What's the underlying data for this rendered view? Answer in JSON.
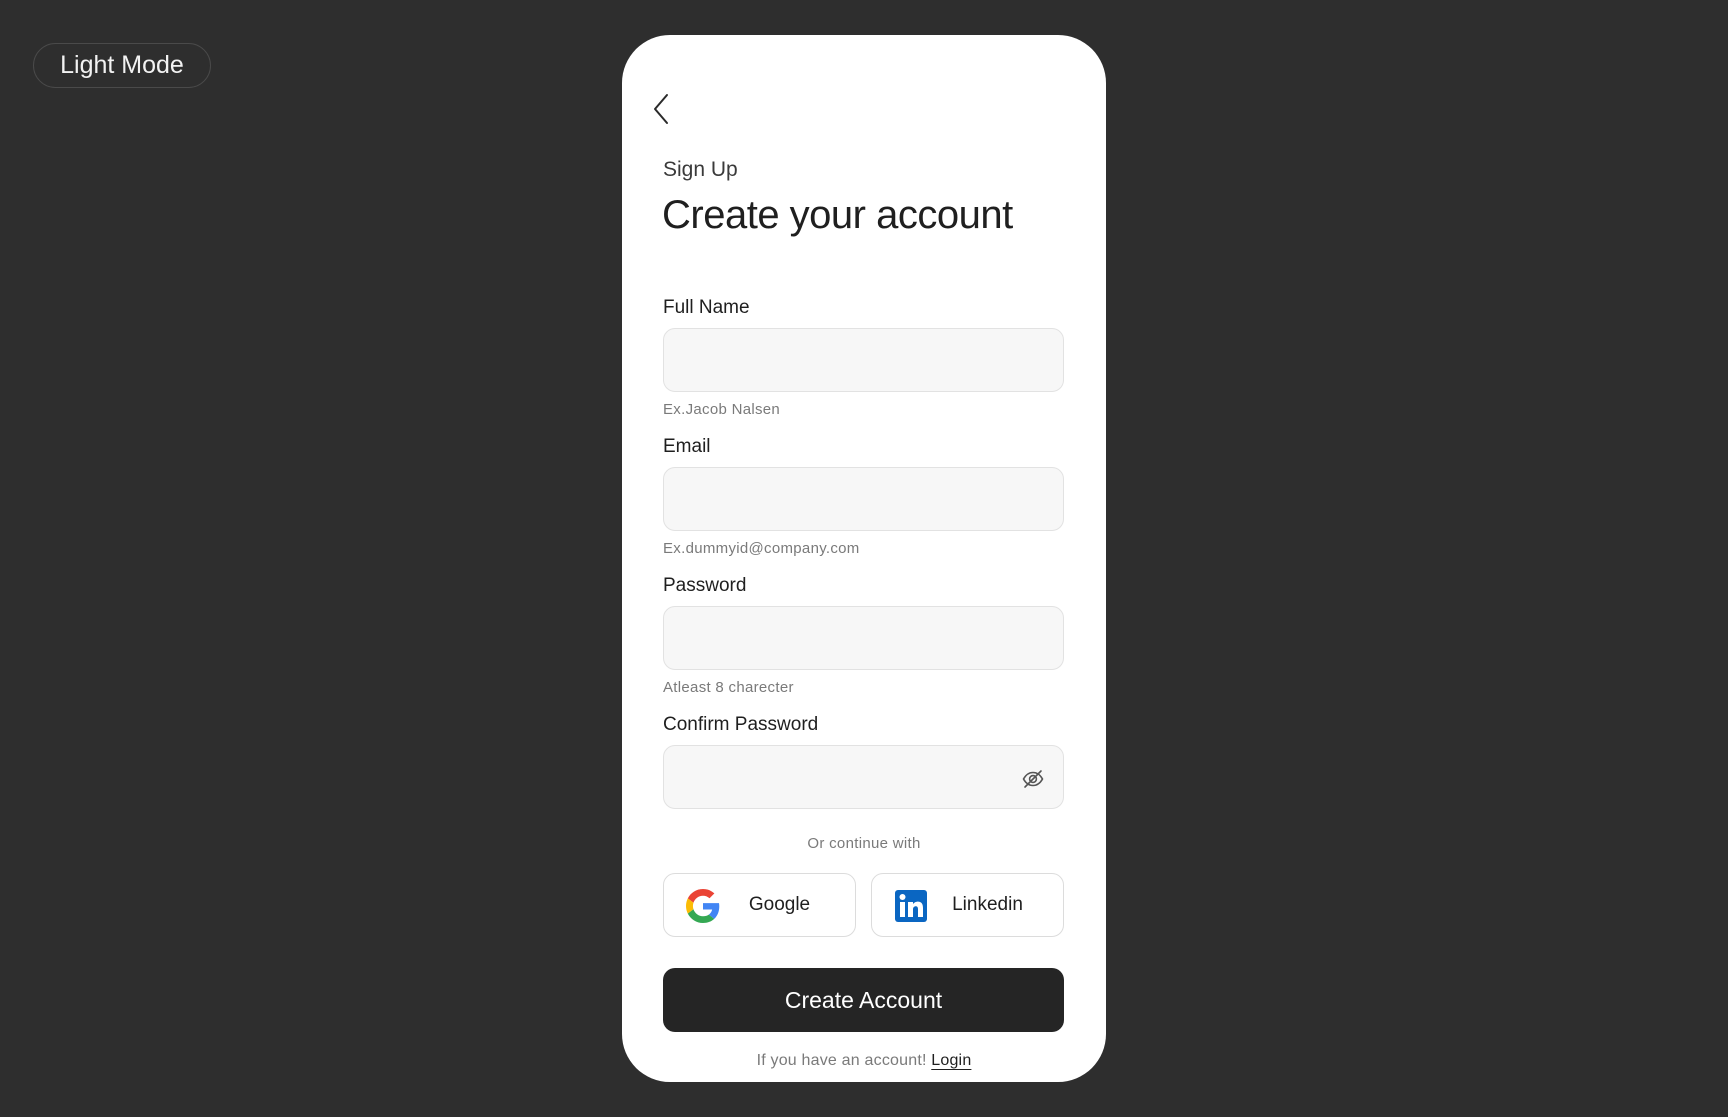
{
  "mode_toggle": {
    "label": "Light Mode"
  },
  "header": {
    "back_icon": "chevron-left-icon",
    "eyebrow": "Sign Up",
    "title": "Create your account"
  },
  "form": {
    "full_name": {
      "label": "Full Name",
      "value": "",
      "hint": "Ex.Jacob Nalsen"
    },
    "email": {
      "label": "Email",
      "value": "",
      "hint": "Ex.dummyid@company.com"
    },
    "password": {
      "label": "Password",
      "value": "",
      "hint": "Atleast 8 charecter"
    },
    "confirm_password": {
      "label": "Confirm Password",
      "value": "",
      "toggle_icon": "eye-off-icon"
    }
  },
  "social": {
    "divider": "Or continue with",
    "google": {
      "label": "Google",
      "icon": "google-icon"
    },
    "linkedin": {
      "label": "Linkedin",
      "icon": "linkedin-icon"
    }
  },
  "submit": {
    "label": "Create Account"
  },
  "footer": {
    "prompt": "If you have an account!",
    "link": "Login"
  },
  "colors": {
    "background": "#2e2e2e",
    "card": "#ffffff",
    "primary_button": "#252525",
    "field_bg": "#f7f7f7",
    "linkedin_blue": "#0a66c2"
  }
}
